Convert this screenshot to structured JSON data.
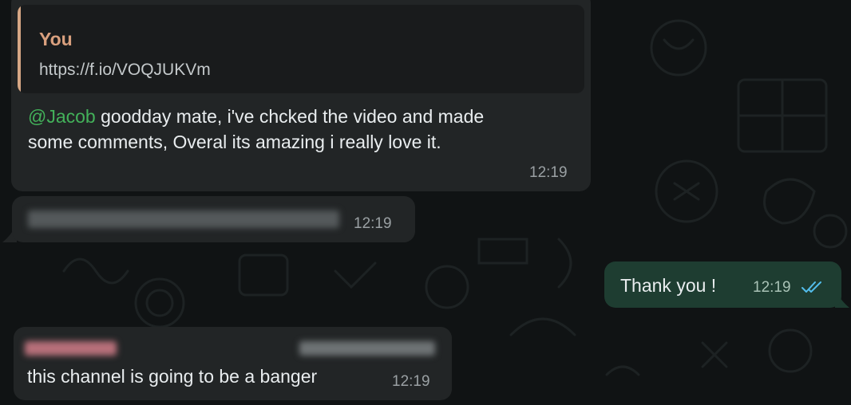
{
  "messages": [
    {
      "quote": {
        "author": "You",
        "text": "https://f.io/VOQJUKVm"
      },
      "mention": "@Jacob",
      "text_line1": " goodday mate, i've chcked the video and made",
      "text_line2": "some comments, Overal its amazing i really love it.",
      "time": "12:19"
    },
    {
      "text": "",
      "time": "12:19",
      "blurred": true
    },
    {
      "text": "Thank you !",
      "time": "12:19",
      "status": "read-double-check-icon"
    },
    {
      "sender": "",
      "sender_meta": "",
      "text": "this channel is going to be a banger",
      "time": "12:19"
    }
  ],
  "colors": {
    "background": "#101314",
    "incoming_bubble": "#222526",
    "outgoing_bubble": "#1e3d31",
    "mention": "#43b15a",
    "quote_author": "#d9a07e",
    "read_ticks": "#53bdeb"
  }
}
